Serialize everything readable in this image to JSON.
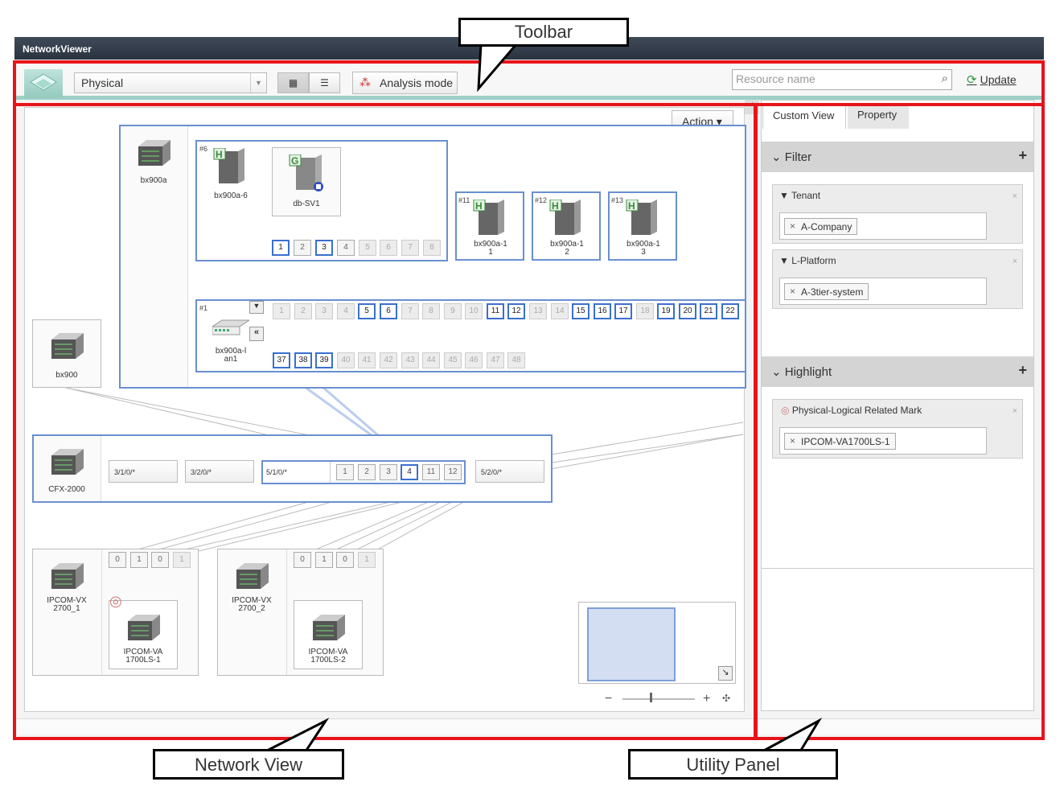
{
  "app": {
    "title": "NetworkViewer"
  },
  "toolbar": {
    "view_select": "Physical",
    "analysis_mode": "Analysis mode",
    "search_placeholder": "Resource name",
    "update": "Update"
  },
  "network": {
    "action": "Action",
    "top_switch": "bx900a",
    "left_switch": "bx900",
    "blade": {
      "num": "#6",
      "name": "bx900a-6",
      "badge": "H"
    },
    "vm": {
      "name": "db-SV1",
      "badge": "G"
    },
    "blade_ports": [
      "1",
      "2",
      "3",
      "4",
      "5",
      "6",
      "7",
      "8"
    ],
    "blade11": {
      "num": "#11",
      "name": "bx900a-1\n1"
    },
    "blade12": {
      "num": "#12",
      "name": "bx900a-1\n2"
    },
    "blade13": {
      "num": "#13",
      "name": "bx900a-1\n3"
    },
    "lan": {
      "num": "#1",
      "name": "bx900a-l\nan1"
    },
    "lan_ports_top": [
      "1",
      "2",
      "3",
      "4",
      "5",
      "6",
      "7",
      "8",
      "9",
      "10",
      "11",
      "12",
      "13",
      "14",
      "15",
      "16",
      "17",
      "18",
      "19",
      "20",
      "21",
      "22"
    ],
    "lan_ports_bottom": [
      "37",
      "38",
      "39",
      "40",
      "41",
      "42",
      "43",
      "44",
      "45",
      "46",
      "47",
      "48"
    ],
    "cfx": {
      "name": "CFX-2000",
      "slots": [
        "3/1/0/*",
        "3/2/0/*",
        "5/1/0/*",
        "5/2/0/*"
      ],
      "ports": [
        "1",
        "2",
        "3",
        "4",
        "11",
        "12"
      ]
    },
    "ipcom1": {
      "name": "IPCOM-VX\n2700_1",
      "child": "IPCOM-VA\n1700LS-1",
      "ports": [
        "0",
        "1",
        "0",
        "1"
      ]
    },
    "ipcom2": {
      "name": "IPCOM-VX\n2700_2",
      "child": "IPCOM-VA\n1700LS-2",
      "ports": [
        "0",
        "1",
        "0",
        "1"
      ]
    }
  },
  "utility": {
    "tabs": [
      "Custom View",
      "Property"
    ],
    "filter": {
      "title": "Filter",
      "cards": [
        {
          "label": "Tenant",
          "value": "A-Company"
        },
        {
          "label": "L-Platform",
          "value": "A-3tier-system"
        }
      ]
    },
    "highlight": {
      "title": "Highlight",
      "card": {
        "label": "Physical-Logical Related Mark",
        "value": "IPCOM-VA1700LS-1"
      }
    }
  },
  "callouts": {
    "toolbar": "Toolbar",
    "network_view": "Network View",
    "utility_panel": "Utility Panel"
  },
  "colors": {
    "highlight_red": "#e8131a",
    "link_blue": "#3a6fd0",
    "accent_teal": "#9dd0c6"
  }
}
